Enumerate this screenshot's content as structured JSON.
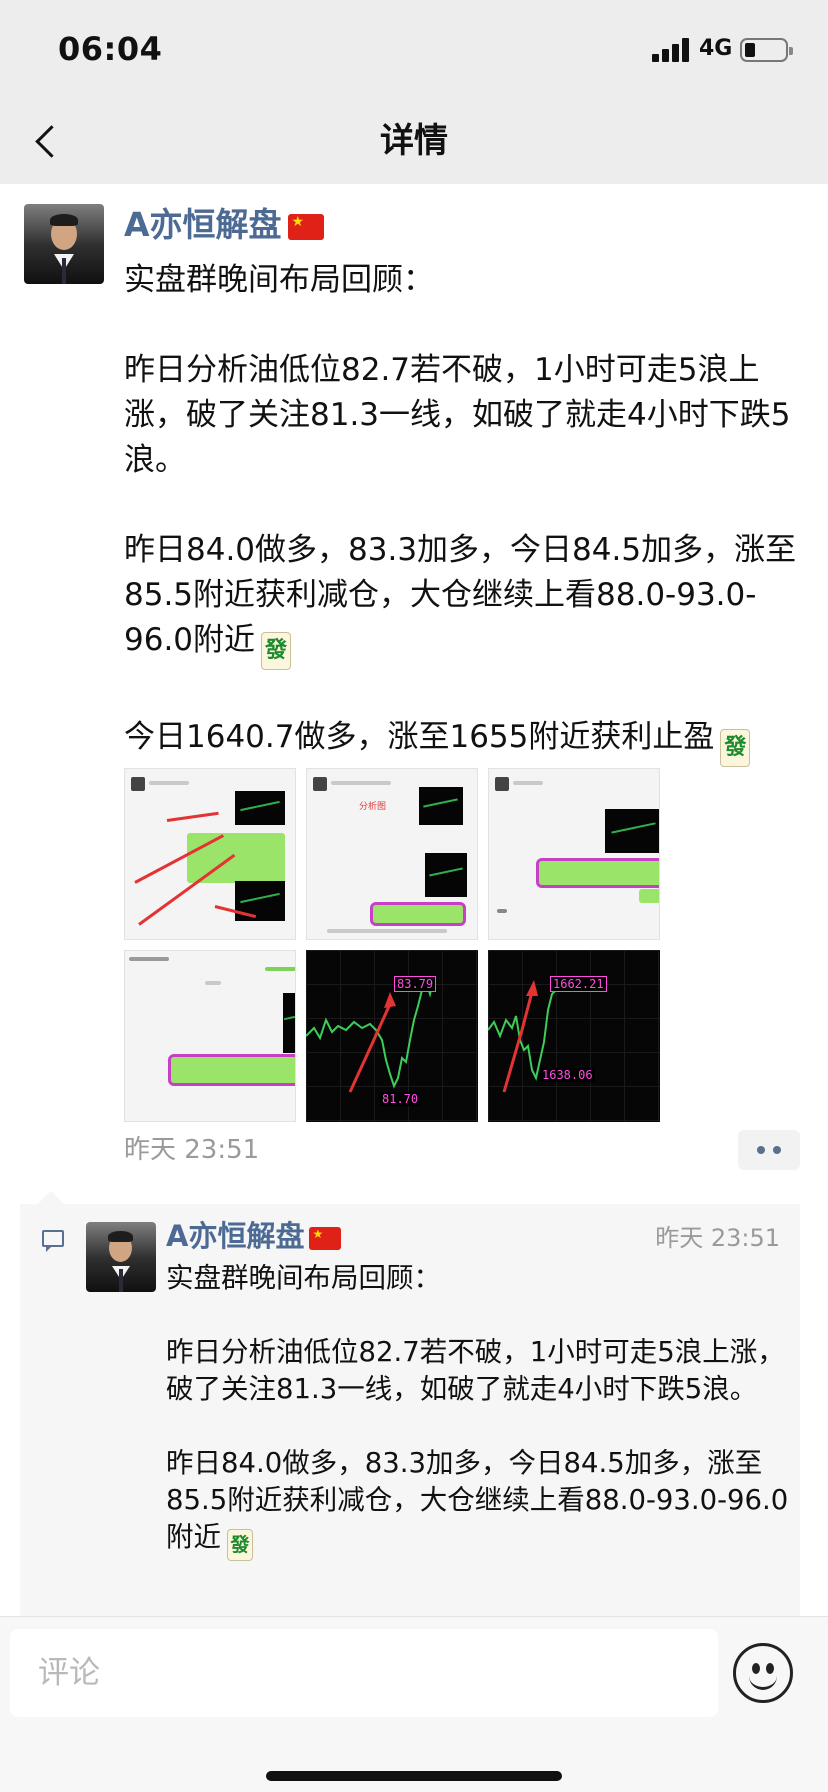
{
  "status_bar": {
    "time": "06:04",
    "network": "4G"
  },
  "nav": {
    "title": "详情"
  },
  "post": {
    "author": "A亦恒解盘",
    "paragraphs": [
      "实盘群晚间布局回顾：",
      "昨日分析油低位82.7若不破，1小时可走5浪上涨，破了关注81.3一线，如破了就走4小时下跌5浪。",
      "昨日84.0做多，83.3加多，今日84.5加多，涨至85.5附近获利减仓，大仓继续上看88.0-93.0-96.0附近",
      "今日1640.7做多，涨至1655附近获利止盈"
    ],
    "emoji_tile": "發",
    "images": [
      {
        "name": "screenshot-1"
      },
      {
        "name": "screenshot-2",
        "caption": "分析图"
      },
      {
        "name": "screenshot-3"
      },
      {
        "name": "screenshot-4"
      },
      {
        "name": "chart-oil",
        "label_high": "83.79",
        "label_low": "81.70"
      },
      {
        "name": "chart-gold",
        "label_high": "1662.21",
        "label_low": "1638.06"
      }
    ],
    "time": "昨天 23:51"
  },
  "comment": {
    "author": "A亦恒解盘",
    "time": "昨天 23:51",
    "paragraphs": [
      "实盘群晚间布局回顾：",
      "昨日分析油低位82.7若不破，1小时可走5浪上涨，破了关注81.3一线，如破了就走4小时下跌5浪。",
      "昨日84.0做多，83.3加多，今日84.5加多，涨至85.5附近获利减仓，大仓继续上看88.0-93.0-96.0附近"
    ]
  },
  "input": {
    "placeholder": "评论",
    "value": ""
  },
  "icons": {
    "back": "chevron-left-icon",
    "more": "more-dots-icon",
    "comment": "comment-icon",
    "emoji": "emoji-icon",
    "flag": "china-flag-icon",
    "tile": "mahjong-fa-icon"
  },
  "colors": {
    "name": "#4d6a95",
    "background": "#ededed",
    "comment_bg": "#f6f6f6",
    "bubble_green": "#9be46a",
    "highlight": "#c640c6"
  }
}
